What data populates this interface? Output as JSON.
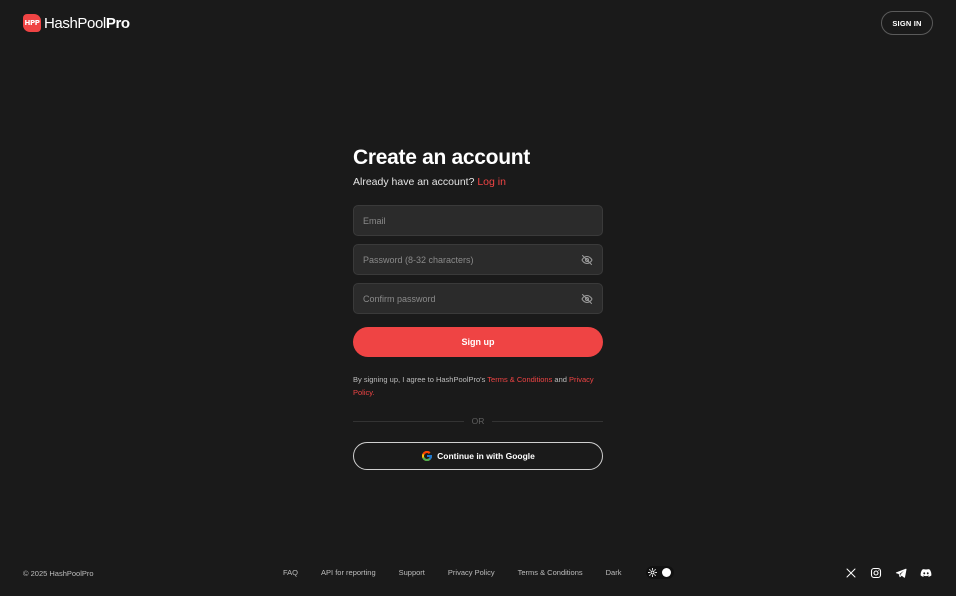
{
  "header": {
    "logo": {
      "mark": "HPP",
      "text_regular": "HashPool",
      "text_bold": "Pro"
    },
    "signin_label": "SIGN IN"
  },
  "form": {
    "title": "Create an account",
    "subtitle_prefix": "Already have an account?",
    "login_link": "Log in",
    "email_placeholder": "Email",
    "password_placeholder": "Password (8-32 characters)",
    "confirm_placeholder": "Confirm password",
    "signup_label": "Sign up",
    "terms_prefix": "By signing up, I agree to HashPoolPro's",
    "terms_link": "Terms & Conditions",
    "terms_and": "and",
    "privacy_link": "Privacy Policy.",
    "or_label": "OR",
    "google_label": "Continue in with Google"
  },
  "footer": {
    "copyright": "© 2025 HashPoolPro",
    "links": [
      "FAQ",
      "API for reporting",
      "Support",
      "Privacy Policy",
      "Terms & Conditions"
    ],
    "theme_label": "Dark",
    "socials": [
      "x-icon",
      "instagram-icon",
      "telegram-icon",
      "discord-icon"
    ]
  },
  "colors": {
    "background": "#1a1a1a",
    "accent": "#ef4444",
    "input_bg": "#2b2b2b"
  }
}
